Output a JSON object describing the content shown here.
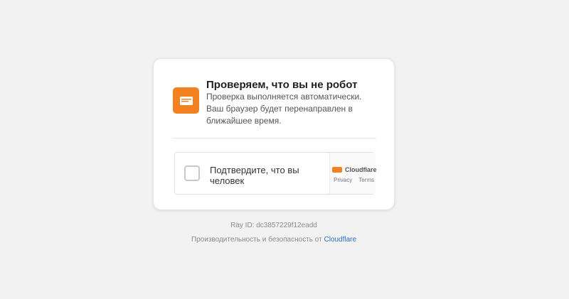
{
  "card": {
    "title": "Проверяем, что вы не робот",
    "subtitle": "Проверка выполняется автоматически. Ваш браузер будет перенаправлен в ближайшее время.",
    "icon": "cloudflare-shield-icon"
  },
  "widget": {
    "checkbox_label": "Подтвердите, что вы человек",
    "brand_name": "Cloudflare",
    "privacy_label": "Privacy",
    "terms_label": "Terms"
  },
  "footer": {
    "ray_id": "Ray ID: dc3857229f12eadd",
    "performance_text": "Производительность и безопасность от",
    "cloudflare_link": "Cloudflare"
  },
  "colors": {
    "accent": "#f48120",
    "link": "#2d6fc2",
    "background": "#f2f2f2"
  }
}
